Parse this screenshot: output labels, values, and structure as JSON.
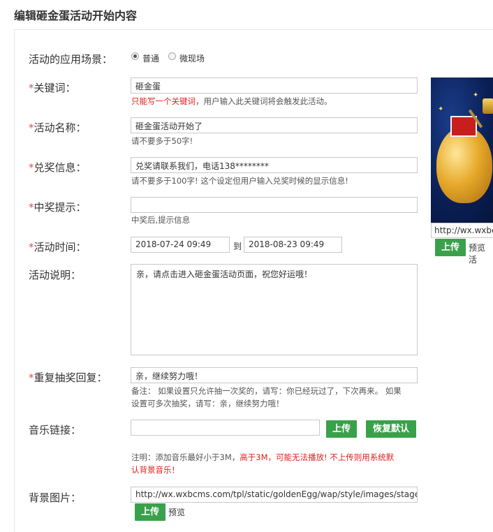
{
  "page": {
    "title": "编辑砸金蛋活动开始内容"
  },
  "scene": {
    "label": "活动的应用场景：",
    "options": [
      {
        "label": "普通",
        "checked": true
      },
      {
        "label": "微现场",
        "checked": false
      }
    ]
  },
  "keyword": {
    "label": "关键词：",
    "value": "砸金蛋",
    "hint_red": "只能写一个关键词",
    "hint_rest": "，用户输入此关键词将会触发此活动。"
  },
  "activity_name": {
    "label": "活动名称：",
    "value": "砸金蛋活动开始了",
    "hint": "请不要多于50字!"
  },
  "redeem_info": {
    "label": "兑奖信息：",
    "value": "兑奖请联系我们，电话138********",
    "hint": "请不要多于100字! 这个设定但用户输入兑奖时候的显示信息!"
  },
  "win_tip": {
    "label": "中奖提示：",
    "value": "",
    "hint": "中奖后,提示信息"
  },
  "activity_time": {
    "label": "活动时间：",
    "start": "2018-07-24 09:49",
    "separator": "到",
    "end": "2018-08-23 09:49"
  },
  "description": {
    "label": "活动说明：",
    "value": "亲，请点击进入砸金蛋活动页面，祝您好运哦！"
  },
  "repeat_reply": {
    "label": "重复抽奖回复：",
    "value": "亲，继续努力哦！",
    "hint_line1": "备注： 如果设置只允许抽一次奖的，请写：你已经玩过了，下次再来。 如果",
    "hint_line2": "设置可多次抽奖，请写：亲，继续努力哦！"
  },
  "music": {
    "label": "音乐链接：",
    "value": "",
    "upload_label": "上传",
    "reset_label": "恢复默认",
    "note_a": "注明：添加音乐最好小于3M，",
    "note_red": "高于3M，可能无法播放!   不上传则用系统默",
    "note_red2": "认背景音乐！"
  },
  "background": {
    "label": "背景图片：",
    "value": "http://wx.wxbcms.com/tpl/static/goldenEgg/wap/style/images/stage.",
    "upload_label": "上传",
    "preview_label": "预览"
  },
  "side_image": {
    "url_value": "http://wx.wxbcms.com",
    "upload_label": "上传",
    "preview_label": "预览 活"
  },
  "colors": {
    "accent_green": "#3aa14b",
    "required_red": "#d9534f",
    "hint_red": "#e02020"
  }
}
